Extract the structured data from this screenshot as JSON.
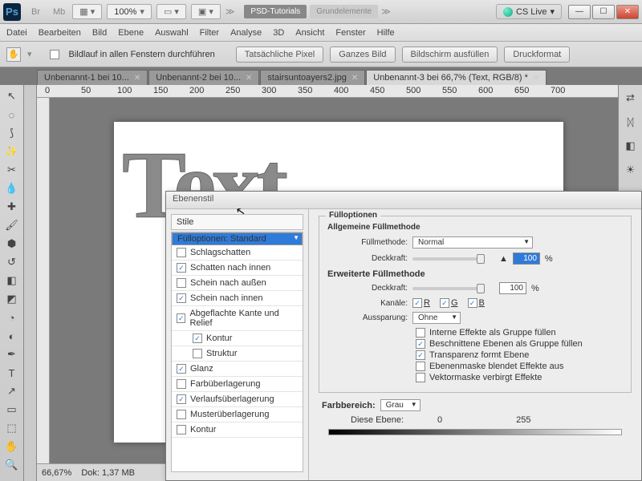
{
  "app": {
    "icon": "Ps",
    "zoom": "100%",
    "frame": "Br",
    "mb": "Mb"
  },
  "titlepills": {
    "tut": "PSD-Tutorials",
    "grund": "Grundelementе"
  },
  "cslive": "CS Live",
  "menu": [
    "Datei",
    "Bearbeiten",
    "Bild",
    "Ebene",
    "Auswahl",
    "Filter",
    "Analyse",
    "3D",
    "Ansicht",
    "Fenster",
    "Hilfe"
  ],
  "optbar": {
    "scroll": "Bildlauf in allen Fenstern durchführen",
    "b1": "Tatsächliche Pixel",
    "b2": "Ganzes Bild",
    "b3": "Bildschirm ausfüllen",
    "b4": "Druckformat"
  },
  "tabs": [
    {
      "label": "Unbenannt-1 bei 10..."
    },
    {
      "label": "Unbenannt-2 bei 10..."
    },
    {
      "label": "stairsuntoayers2.jpg"
    },
    {
      "label": "Unbenannt-3 bei 66,7% (Text, RGB/8) *"
    }
  ],
  "canvas": {
    "text": "Text"
  },
  "status": {
    "zoom": "66,67%",
    "doc": "Dok: 1,37 MB"
  },
  "ruler": [
    "0",
    "50",
    "100",
    "150",
    "200",
    "250",
    "300",
    "350",
    "400",
    "450",
    "500",
    "550",
    "600",
    "650",
    "700"
  ],
  "dialog": {
    "title": "Ebenenstil",
    "stile": "Stile",
    "items": [
      {
        "label": "Fülloptionen: Standard",
        "sel": true
      },
      {
        "label": "Schlagschatten",
        "chk": false
      },
      {
        "label": "Schatten nach innen",
        "chk": true
      },
      {
        "label": "Schein nach außen",
        "chk": false
      },
      {
        "label": "Schein nach innen",
        "chk": true
      },
      {
        "label": "Abgeflachte Kante und Relief",
        "chk": true
      },
      {
        "label": "Kontur",
        "chk": true,
        "indent": true
      },
      {
        "label": "Struktur",
        "chk": false,
        "indent": true
      },
      {
        "label": "Glanz",
        "chk": true
      },
      {
        "label": "Farbüberlagerung",
        "chk": false
      },
      {
        "label": "Verlaufsüberlagerung",
        "chk": true
      },
      {
        "label": "Musterüberlagerung",
        "chk": false
      },
      {
        "label": "Kontur",
        "chk": false
      }
    ],
    "fill": {
      "heading": "Fülloptionen",
      "general": "Allgemeine Füllmethode",
      "methodLabel": "Füllmethode:",
      "method": "Normal",
      "opacityLabel": "Deckkraft:",
      "opacity": "100",
      "pct": "%",
      "adv": "Erweiterte Füllmethode",
      "opacity2": "100",
      "chanLabel": "Kanäle:",
      "chR": "R",
      "chG": "G",
      "chB": "B",
      "knockLabel": "Aussparung:",
      "knock": "Ohne",
      "o1": "Interne Effekte als Gruppe füllen",
      "o2": "Beschnittene Ebenen als Gruppe füllen",
      "o3": "Transparenz formt Ebene",
      "o4": "Ebenenmaske blendet Effekte aus",
      "o5": "Vektormaske verbirgt Effekte",
      "rangeLabel": "Farbbereich:",
      "range": "Grau",
      "thisLayer": "Diese Ebene:",
      "v0": "0",
      "v255": "255"
    }
  }
}
